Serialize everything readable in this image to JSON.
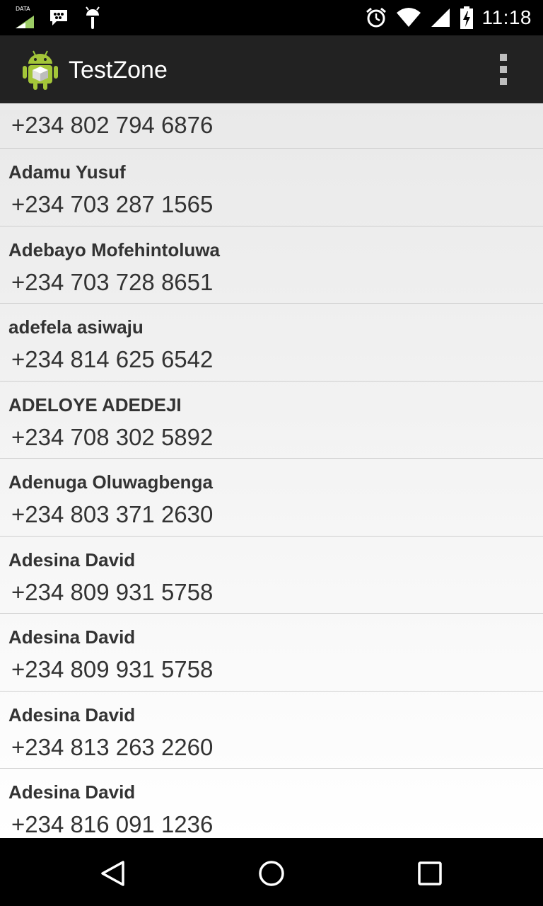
{
  "status_bar": {
    "data_label": "DATA",
    "time": "11:18",
    "icons": [
      "data-signal-icon",
      "bbm-icon",
      "android-debug-icon",
      "alarm-icon",
      "wifi-icon",
      "cell-signal-icon",
      "battery-charging-icon"
    ]
  },
  "action_bar": {
    "title": "TestZone",
    "app_icon": "android-app-icon",
    "overflow_icon": "overflow-menu-icon"
  },
  "contacts": {
    "first_partial_phone": "+234 802 794 6876",
    "items": [
      {
        "name": "Adamu Yusuf",
        "phone": "+234 703 287 1565"
      },
      {
        "name": "Adebayo Mofehintoluwa",
        "phone": "+234 703 728 8651"
      },
      {
        "name": "adefela asiwaju",
        "phone": "+234 814 625 6542"
      },
      {
        "name": "ADELOYE ADEDEJI",
        "phone": "+234 708 302 5892"
      },
      {
        "name": "Adenuga Oluwagbenga",
        "phone": "+234 803 371 2630"
      },
      {
        "name": "Adesina David",
        "phone": "+234 809 931 5758"
      },
      {
        "name": "Adesina David",
        "phone": "+234 809 931 5758"
      },
      {
        "name": "Adesina David",
        "phone": "+234 813 263 2260"
      },
      {
        "name": "Adesina David",
        "phone": "+234 816 091 1236"
      }
    ]
  },
  "nav_bar": {
    "icons": [
      "back-icon",
      "home-icon",
      "recents-icon"
    ]
  }
}
